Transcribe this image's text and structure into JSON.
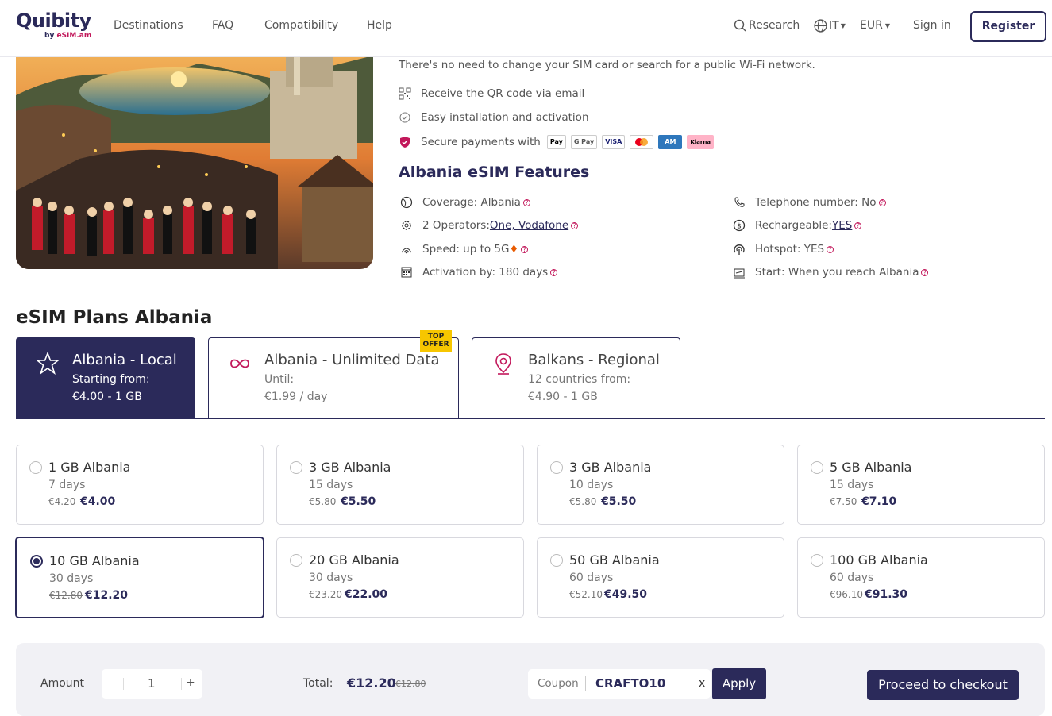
{
  "header": {
    "logo_text": "Quibity",
    "logo_sub_prefix": "by ",
    "logo_sub_brand": "eSIM",
    "logo_sub_suffix": ".am",
    "nav": [
      "Destinations",
      "FAQ",
      "Compatibility",
      "Help"
    ],
    "research": "Research",
    "language": "IT",
    "currency": "EUR",
    "sign_in": "Sign in",
    "register": "Register"
  },
  "intro": "There's no need to change your SIM card or search for a public Wi-Fi network.",
  "highlights": {
    "qr": "Receive the QR code via email",
    "install": "Easy installation and activation",
    "payments": "Secure payments with",
    "payment_methods": [
      "Pay",
      "G Pay",
      "VISA",
      "MC",
      "AMEX",
      "Klarna"
    ]
  },
  "features": {
    "title": "Albania eSIM Features",
    "coverage": "Coverage: Albania",
    "operators_prefix": "2 Operators: ",
    "operators": "One, Vodafone",
    "speed": "Speed: up to 5G",
    "activation": "Activation by: 180 days",
    "telephone": "Telephone number: No",
    "rechargeable_prefix": "Rechargeable: ",
    "rechargeable": "YES",
    "hotspot": "Hotspot: YES",
    "start": "Start: When you reach Albania"
  },
  "plans_title": "eSIM Plans Albania",
  "tabs": [
    {
      "title": "Albania - Local",
      "sub": "Starting from:",
      "sub2": "€4.00 - 1 GB"
    },
    {
      "title": "Albania - Unlimited Data",
      "sub": "Until:",
      "sub2": "€1.99 / day",
      "badge": "TOP OFFER"
    },
    {
      "title": "Balkans - Regional",
      "sub": "12 countries from:",
      "sub2": "€4.90 - 1 GB"
    }
  ],
  "plans": [
    {
      "name": "1 GB Albania",
      "days": "7 days",
      "old": "€4.20",
      "price": "€4.00"
    },
    {
      "name": "3 GB Albania",
      "days": "15 days",
      "old": "€5.80",
      "price": "€5.50"
    },
    {
      "name": "3 GB Albania",
      "days": "10 days",
      "old": "€5.80",
      "price": "€5.50"
    },
    {
      "name": "5 GB Albania",
      "days": "15 days",
      "old": "€7.50",
      "price": "€7.10"
    },
    {
      "name": "10 GB Albania",
      "days": "30 days",
      "old": "€12.80",
      "price": "€12.20"
    },
    {
      "name": "20 GB Albania",
      "days": "30 days",
      "old": "€23.20",
      "price": "€22.00"
    },
    {
      "name": "50 GB Albania",
      "days": "60 days",
      "old": "€52.10",
      "price": "€49.50"
    },
    {
      "name": "100 GB Albania",
      "days": "60 days",
      "old": "€96.10",
      "price": "€91.30"
    }
  ],
  "checkout_bar": {
    "amount_label": "Amount",
    "minus": "–",
    "quantity": "1",
    "plus": "+",
    "total_label": "Total:",
    "total": "€12.20",
    "total_old": "€12.80",
    "coupon_label": "Coupon",
    "coupon_code": "CRAFTO10",
    "clear": "x",
    "apply": "Apply",
    "checkout": "Proceed to checkout"
  },
  "colors": {
    "brand": "#2b2a5a",
    "accent": "#c2185b"
  }
}
